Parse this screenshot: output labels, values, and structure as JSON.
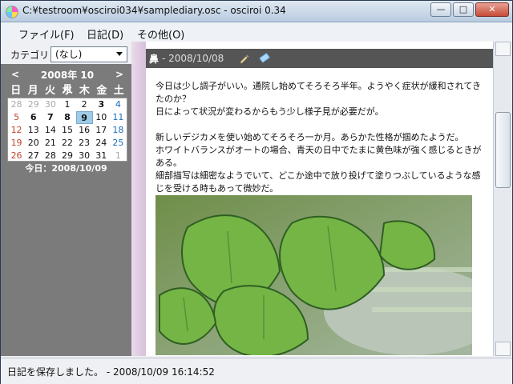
{
  "window": {
    "title": "C:¥testroom¥osciroi034¥samplediary.osc - osciroi 0.34",
    "buttons": {
      "minimize": "—",
      "maximize": "□",
      "close": "✕"
    }
  },
  "menu": {
    "items": [
      "ファイル(F)",
      "日記(D)",
      "その他(O)"
    ]
  },
  "sidebar": {
    "category_label": "カテゴリ：",
    "category_value": "(なし)",
    "calendar": {
      "prev": "<",
      "next": ">",
      "month_label": "2008年 10月",
      "weekdays": [
        "日",
        "月",
        "火",
        "水",
        "木",
        "金",
        "土"
      ],
      "rows": [
        [
          "28",
          "29",
          "30",
          "1",
          "2",
          "3",
          "4"
        ],
        [
          "5",
          "6",
          "7",
          "8",
          "9",
          "10",
          "11"
        ],
        [
          "12",
          "13",
          "14",
          "15",
          "16",
          "17",
          "18"
        ],
        [
          "19",
          "20",
          "21",
          "22",
          "23",
          "24",
          "25"
        ],
        [
          "26",
          "27",
          "28",
          "29",
          "30",
          "31",
          "1"
        ]
      ],
      "today_label": "今日：2008/10/09"
    }
  },
  "entry": {
    "title": "鼻",
    "date": "- 2008/10/08",
    "paragraphs": [
      "今日は少し調子がいい。通院し始めてそろそろ半年。ようやく症状が緩和されてきたのか？",
      "日によって状況が変わるからもう少し様子見が必要だが。",
      "新しいデジカメを使い始めてそろそろ一か月。あらかた性格が掴めたようだ。",
      "ホワイトバランスがオートの場合、青天の日中でたまに黄色味が強く感じるときがある。",
      "細部描写は細密なようでいて、どこか途中で放り投げて塗りつぶしているような感じを受ける時もあって微妙だ。"
    ]
  },
  "status": {
    "message": "日記を保存しました。 - 2008/10/09 16:14:52"
  },
  "colors": {
    "sidebar_bg": "#7b7b7b",
    "header_bg": "#555555",
    "today_highlight": "#9ecbe8",
    "sunday": "#c0462f",
    "saturday": "#1a6fbe"
  }
}
